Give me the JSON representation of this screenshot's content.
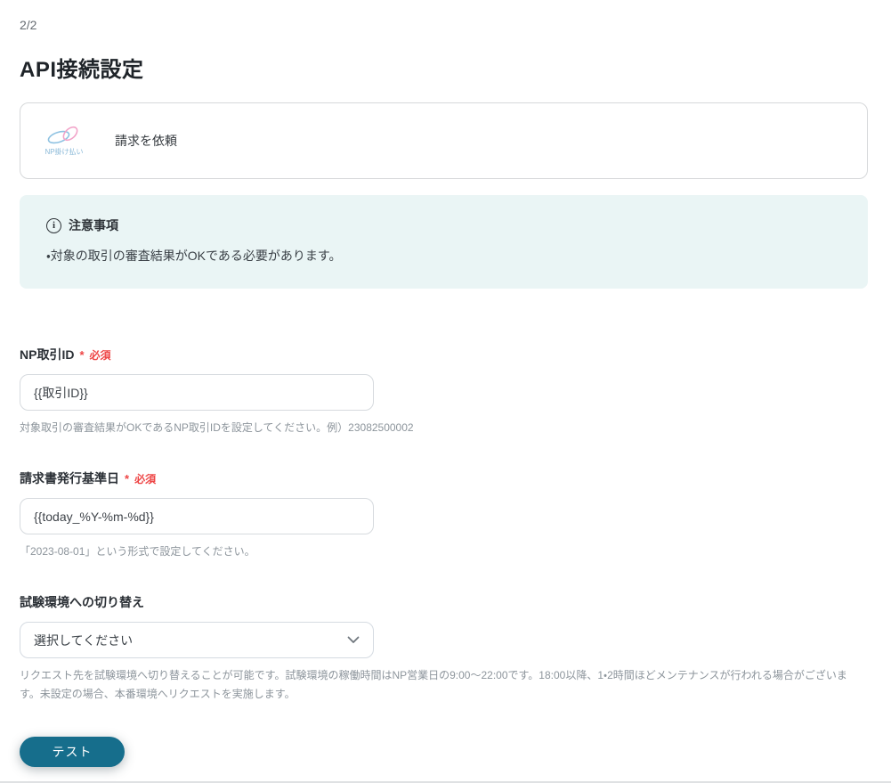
{
  "page": {
    "indicator": "2/2",
    "title": "API接続設定"
  },
  "action_card": {
    "logo_text": "NP掛け払い",
    "label": "請求を依頼"
  },
  "notice": {
    "title": "注意事項",
    "item": "・対象の取引の審査結果がOKである必要があります。"
  },
  "form": {
    "required_mark": "*",
    "required_badge": "必須",
    "fields": [
      {
        "label": "NP取引ID",
        "type": "text",
        "value": "{{取引ID}}",
        "helper": "対象取引の審査結果がOKであるNP取引IDを設定してください。例）23082500002"
      },
      {
        "label": "請求書発行基準日",
        "type": "text",
        "value": "{{today_%Y-%m-%d}}",
        "helper": "「2023-08-01」という形式で設定してください。"
      },
      {
        "label": "試験環境への切り替え",
        "type": "select",
        "value": "選択してください",
        "helper": "リクエスト先を試験環境へ切り替えることが可能です。試験環境の稼働時間はNP営業日の9:00〜22:00です。18:00以降、1・2時間ほどメンテナンスが行われる場合がございます。未設定の場合、本番環境へリクエストを実施します。"
      }
    ]
  },
  "footer": {
    "test_button_label": "テスト"
  },
  "colors": {
    "accent_teal": "#166e8c",
    "required_red": "#ee4545",
    "notice_bg": "#eaf5f5",
    "logo_blue": "#8ec2e2",
    "logo_pink": "#f2a4c9"
  }
}
